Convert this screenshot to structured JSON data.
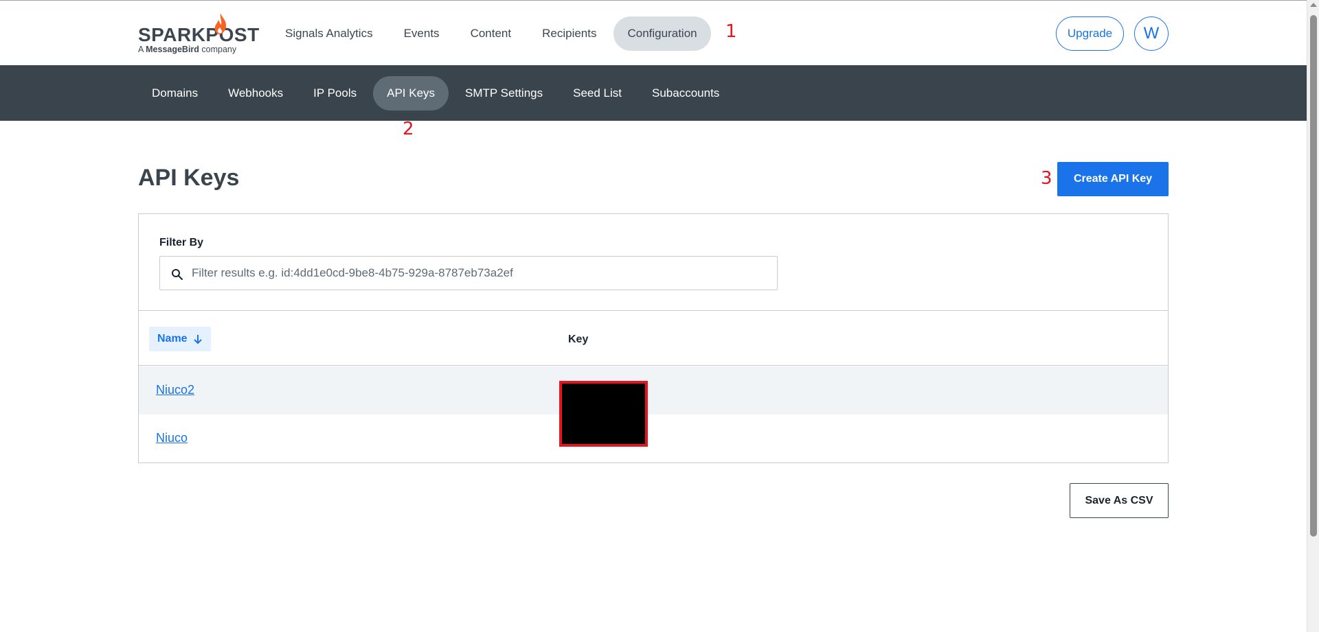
{
  "brand": {
    "logo_word": "SPARKPOST",
    "logo_sub_prefix": "A ",
    "logo_sub_bold": "MessageBird",
    "logo_sub_suffix": " company",
    "flame_color": "#fa6423"
  },
  "nav": {
    "items": [
      {
        "label": "Signals Analytics",
        "active": false
      },
      {
        "label": "Events",
        "active": false
      },
      {
        "label": "Content",
        "active": false
      },
      {
        "label": "Recipients",
        "active": false
      },
      {
        "label": "Configuration",
        "active": true
      }
    ],
    "upgrade_label": "Upgrade",
    "avatar_initial": "W"
  },
  "subnav": {
    "items": [
      {
        "label": "Domains",
        "active": false
      },
      {
        "label": "Webhooks",
        "active": false
      },
      {
        "label": "IP Pools",
        "active": false
      },
      {
        "label": "API Keys",
        "active": true
      },
      {
        "label": "SMTP Settings",
        "active": false
      },
      {
        "label": "Seed List",
        "active": false
      },
      {
        "label": "Subaccounts",
        "active": false
      }
    ]
  },
  "annotations": [
    "1",
    "2",
    "3"
  ],
  "page": {
    "title": "API Keys",
    "create_button": "Create API Key",
    "filter": {
      "label": "Filter By",
      "placeholder": "Filter results e.g. id:4dd1e0cd-9be8-4b75-929a-8787eb73a2ef",
      "value": ""
    },
    "table": {
      "columns": [
        "Name",
        "Key"
      ],
      "sort_icon": "arrow-down-icon",
      "rows": [
        {
          "name": "Niuco2"
        },
        {
          "name": "Niuco"
        }
      ]
    },
    "csv_button": "Save As CSV"
  },
  "colors": {
    "accent": "#1a73e8",
    "subnav_bg": "#39444d",
    "annotation_red": "#e3151f"
  }
}
